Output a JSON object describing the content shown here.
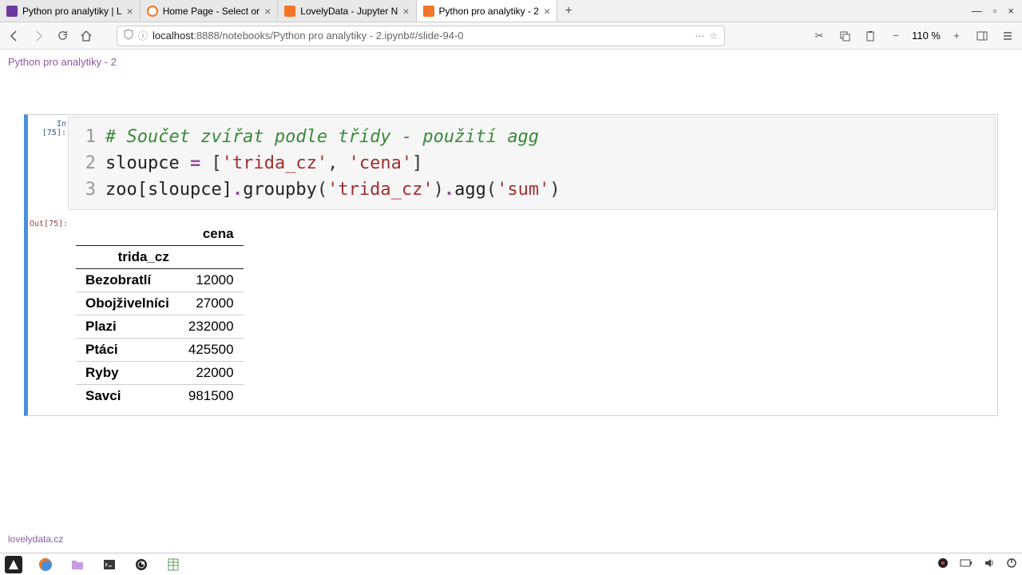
{
  "tabs": [
    {
      "label": "Python pro analytiky | L",
      "favicon_color": "#6b3a9e"
    },
    {
      "label": "Home Page - Select or",
      "favicon_color": "#f37626"
    },
    {
      "label": "LovelyData - Jupyter N",
      "favicon_color": "#f37626"
    },
    {
      "label": "Python pro analytiky - 2",
      "favicon_color": "#f37626"
    }
  ],
  "url": {
    "host": "localhost",
    "rest": ":8888/notebooks/Python pro analytiky - 2.ipynb#/slide-94-0"
  },
  "zoom": "110 %",
  "slide_title": "Python pro analytiky - 2",
  "footer": "lovelydata.cz",
  "cell": {
    "in_prompt": "In [75]:",
    "out_prompt": "Out[75]:",
    "code": {
      "line1_comment": "# Součet zvířat podle třídy - použití agg",
      "line2_var": "sloupce",
      "line2_eq": " = ",
      "line2_lb": "[",
      "line2_s1": "'trida_cz'",
      "line2_comma": ", ",
      "line2_s2": "'cena'",
      "line2_rb": "]",
      "line3_a": "zoo[sloupce]",
      "line3_dot1": ".",
      "line3_m1": "groupby",
      "line3_p1": "(",
      "line3_s1": "'trida_cz'",
      "line3_p2": ")",
      "line3_dot2": ".",
      "line3_m2": "agg",
      "line3_p3": "(",
      "line3_s2": "'sum'",
      "line3_p4": ")"
    }
  },
  "table": {
    "col_header": "cena",
    "index_name": "trida_cz",
    "rows": [
      {
        "idx": "Bezobratlí",
        "val": "12000"
      },
      {
        "idx": "Obojživelníci",
        "val": "27000"
      },
      {
        "idx": "Plazi",
        "val": "232000"
      },
      {
        "idx": "Ptáci",
        "val": "425500"
      },
      {
        "idx": "Ryby",
        "val": "22000"
      },
      {
        "idx": "Savci",
        "val": "981500"
      }
    ]
  },
  "ln": {
    "l1": "1",
    "l2": "2",
    "l3": "3"
  }
}
